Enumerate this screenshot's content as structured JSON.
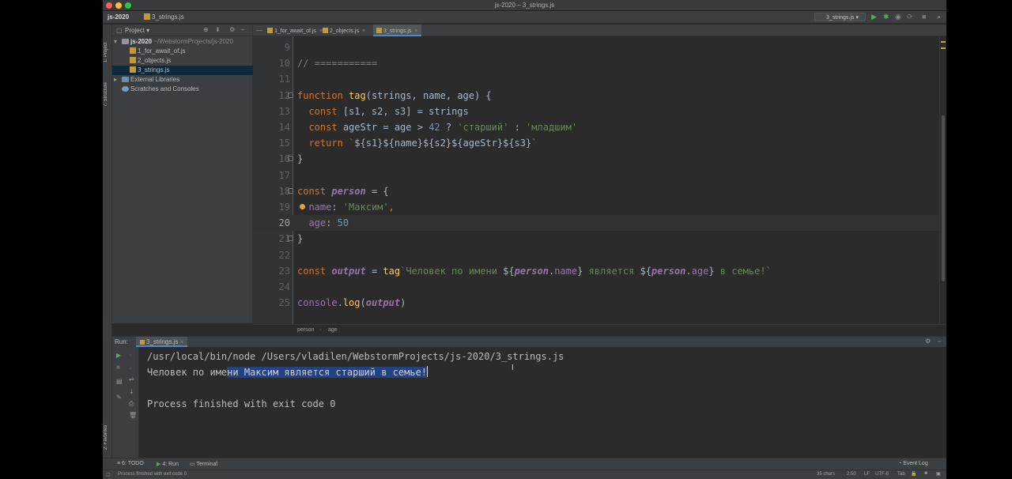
{
  "window": {
    "title": "js-2020 – 3_strings.js"
  },
  "navbar": {
    "project": "js-2020",
    "file": "3_strings.js",
    "run_config": "3_strings.js"
  },
  "left_tools": {
    "project": "1: Project",
    "structure": "7: Structure",
    "favorites": "2: Favorites"
  },
  "project_panel": {
    "title": "Project",
    "root": {
      "name": "js-2020",
      "path": "~/WebstormProjects/js-2020"
    },
    "files": [
      "1_for_await_of.js",
      "2_objects.js",
      "3_strings.js"
    ],
    "external": "External Libraries",
    "scratches": "Scratches and Consoles"
  },
  "tabs": [
    {
      "label": "1_for_await_of.js"
    },
    {
      "label": "2_objects.js"
    },
    {
      "label": "3_strings.js"
    }
  ],
  "editor": {
    "line_numbers": [
      "9",
      "10",
      "11",
      "12",
      "13",
      "14",
      "15",
      "16",
      "17",
      "18",
      "19",
      "20",
      "21",
      "22",
      "23",
      "24",
      "25"
    ],
    "lines": [
      [],
      [
        [
          "cmt",
          "// ==========="
        ]
      ],
      [],
      [
        [
          "kw",
          "function "
        ],
        [
          "fn",
          "tag"
        ],
        [
          "gray",
          "(strings, name, age) {"
        ]
      ],
      [
        [
          "gray",
          "  "
        ],
        [
          "kw",
          "const "
        ],
        [
          "gray",
          "[s1, s2, s3] = strings"
        ]
      ],
      [
        [
          "gray",
          "  "
        ],
        [
          "kw",
          "const "
        ],
        [
          "gray",
          "ageStr = age > "
        ],
        [
          "num",
          "42"
        ],
        [
          "gray",
          " ? "
        ],
        [
          "str",
          "'старший'"
        ],
        [
          "gray",
          " : "
        ],
        [
          "str",
          "'младшим'"
        ]
      ],
      [
        [
          "gray",
          "  "
        ],
        [
          "kw",
          "return "
        ],
        [
          "str",
          "`"
        ],
        [
          "gray",
          "${s1}${name}${s2}${ageStr}${s3}"
        ],
        [
          "str",
          "`"
        ]
      ],
      [
        [
          "gray",
          "}"
        ]
      ],
      [],
      [
        [
          "kw",
          "const "
        ],
        [
          "vd",
          "person"
        ],
        [
          "gray",
          " = {"
        ]
      ],
      [
        [
          "gray",
          "  "
        ],
        [
          "prop",
          "name"
        ],
        [
          "gray",
          ": "
        ],
        [
          "str",
          "'Максим'"
        ],
        [
          "kw",
          ","
        ]
      ],
      [
        [
          "gray",
          "  "
        ],
        [
          "prop",
          "age"
        ],
        [
          "gray",
          ": "
        ],
        [
          "num",
          "50"
        ]
      ],
      [
        [
          "gray",
          "}"
        ]
      ],
      [],
      [
        [
          "kw",
          "const "
        ],
        [
          "vd",
          "output"
        ],
        [
          "gray",
          " = "
        ],
        [
          "fn",
          "tag"
        ],
        [
          "str",
          "`Человек по имени "
        ],
        [
          "gray",
          "${"
        ],
        [
          "vd",
          "person"
        ],
        [
          "gray",
          "."
        ],
        [
          "prop",
          "name"
        ],
        [
          "gray",
          "}"
        ],
        [
          "str",
          " является "
        ],
        [
          "gray",
          "${"
        ],
        [
          "vd",
          "person"
        ],
        [
          "gray",
          "."
        ],
        [
          "prop",
          "age"
        ],
        [
          "gray",
          "}"
        ],
        [
          "str",
          " в семье!`"
        ]
      ],
      [],
      [
        [
          "prop",
          "console"
        ],
        [
          "gray",
          "."
        ],
        [
          "fn",
          "log"
        ],
        [
          "gray",
          "("
        ],
        [
          "vd",
          "output"
        ],
        [
          "gray",
          ")"
        ]
      ]
    ],
    "breadcrumb": [
      "person",
      "age"
    ]
  },
  "run": {
    "label": "Run:",
    "tab": "3_strings.js",
    "command": "/usr/local/bin/node /Users/vladilen/WebstormProjects/js-2020/3_strings.js",
    "output_plain": "Человек по име",
    "output_selected": "ни Максим является старший в семье!",
    "exit": "Process finished with exit code 0"
  },
  "bottom_tabs": {
    "todo": "6: TODO",
    "run": "4: Run",
    "terminal": "Terminal",
    "event_log": "Event Log"
  },
  "status": {
    "message": "Process finished with exit code 0",
    "chars": "35 chars",
    "position": "2:50",
    "line_sep": "LF",
    "encoding": "UTF-8",
    "indent": "Tab"
  },
  "colors": {
    "background": "#2b2b2b",
    "panel": "#3c3f41",
    "selection": "#214283",
    "keyword": "#cc7832",
    "string": "#6a8759",
    "number": "#6897bb",
    "function": "#ffc66d"
  }
}
